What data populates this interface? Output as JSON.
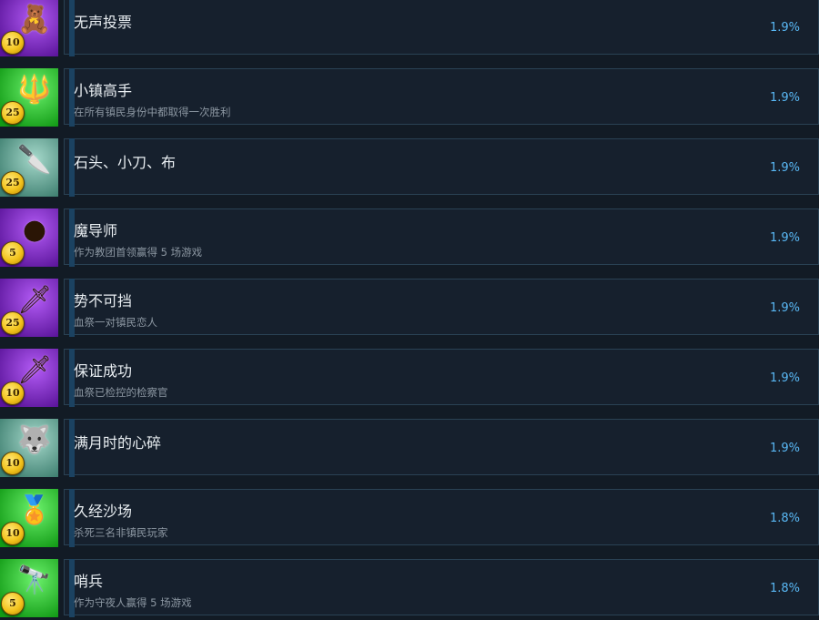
{
  "achievements": [
    {
      "title": "无声投票",
      "description": "",
      "percent": "1.9%",
      "points": "10",
      "icon": "voodoo-doll-icon",
      "icon_glyph": "🧸",
      "bg": [
        "#b35bf5",
        "#5a149a"
      ]
    },
    {
      "title": "小镇高手",
      "description": "在所有镇民身份中都取得一次胜利",
      "percent": "1.9%",
      "points": "25",
      "icon": "pitchfork-icon",
      "icon_glyph": "🔱",
      "bg": [
        "#6cf26c",
        "#119a15"
      ]
    },
    {
      "title": "石头、小刀、布",
      "description": "",
      "percent": "1.9%",
      "points": "25",
      "icon": "knife-icon",
      "icon_glyph": "🔪",
      "bg": [
        "#a6d9cb",
        "#3e7f70"
      ]
    },
    {
      "title": "魔导师",
      "description": "作为教团首领赢得 5 场游戏",
      "percent": "1.9%",
      "points": "5",
      "icon": "dark-orb-icon",
      "icon_glyph": "●",
      "bg": [
        "#b35bf5",
        "#5a149a"
      ]
    },
    {
      "title": "势不可挡",
      "description": "血祭一对镇民恋人",
      "percent": "1.9%",
      "points": "25",
      "icon": "ritual-dagger-icon",
      "icon_glyph": "🗡",
      "bg": [
        "#b35bf5",
        "#5a149a"
      ]
    },
    {
      "title": "保证成功",
      "description": "血祭已检控的检察官",
      "percent": "1.9%",
      "points": "10",
      "icon": "ritual-dagger-icon",
      "icon_glyph": "🗡",
      "bg": [
        "#b35bf5",
        "#5a149a"
      ]
    },
    {
      "title": "满月时的心碎",
      "description": "",
      "percent": "1.9%",
      "points": "10",
      "icon": "werewolf-icon",
      "icon_glyph": "🐺",
      "bg": [
        "#a6d9cb",
        "#3e7f70"
      ]
    },
    {
      "title": "久经沙场",
      "description": "杀死三名非镇民玩家",
      "percent": "1.8%",
      "points": "10",
      "icon": "medal-icon",
      "icon_glyph": "🏅",
      "bg": [
        "#6cf26c",
        "#119a15"
      ]
    },
    {
      "title": "哨兵",
      "description": "作为守夜人赢得 5 场游戏",
      "percent": "1.8%",
      "points": "5",
      "icon": "spyglass-icon",
      "icon_glyph": "🔭",
      "bg": [
        "#6cf26c",
        "#119a15"
      ]
    }
  ]
}
